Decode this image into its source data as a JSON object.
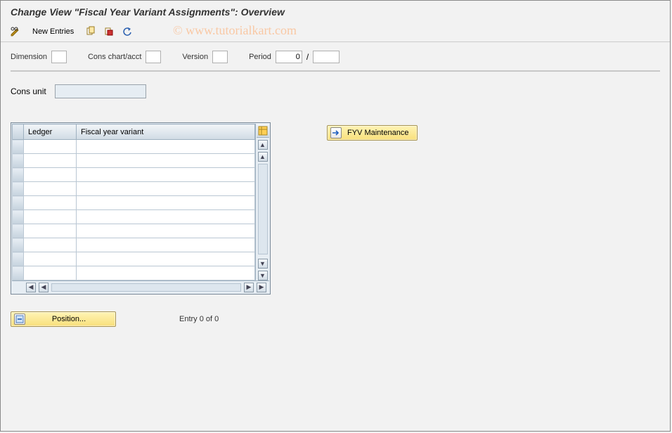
{
  "title": "Change View \"Fiscal Year Variant Assignments\": Overview",
  "watermark": "© www.tutorialkart.com",
  "toolbar": {
    "new_entries_label": "New Entries"
  },
  "filters": {
    "dimension_label": "Dimension",
    "dimension_value": "",
    "cons_chart_label": "Cons chart/acct",
    "cons_chart_value": "",
    "version_label": "Version",
    "version_value": "",
    "period_label": "Period",
    "period_value": "0",
    "period_sep": "/",
    "period2_value": ""
  },
  "cons_unit": {
    "label": "Cons unit",
    "value": ""
  },
  "grid": {
    "columns": {
      "c1": "Ledger",
      "c2": "Fiscal year variant"
    },
    "rows": [
      {
        "ledger": "",
        "fyv": ""
      },
      {
        "ledger": "",
        "fyv": ""
      },
      {
        "ledger": "",
        "fyv": ""
      },
      {
        "ledger": "",
        "fyv": ""
      },
      {
        "ledger": "",
        "fyv": ""
      },
      {
        "ledger": "",
        "fyv": ""
      },
      {
        "ledger": "",
        "fyv": ""
      },
      {
        "ledger": "",
        "fyv": ""
      },
      {
        "ledger": "",
        "fyv": ""
      },
      {
        "ledger": "",
        "fyv": ""
      }
    ]
  },
  "buttons": {
    "fyv_maintenance": "FYV Maintenance",
    "position": "Position..."
  },
  "footer": {
    "entry_text": "Entry 0 of 0"
  }
}
